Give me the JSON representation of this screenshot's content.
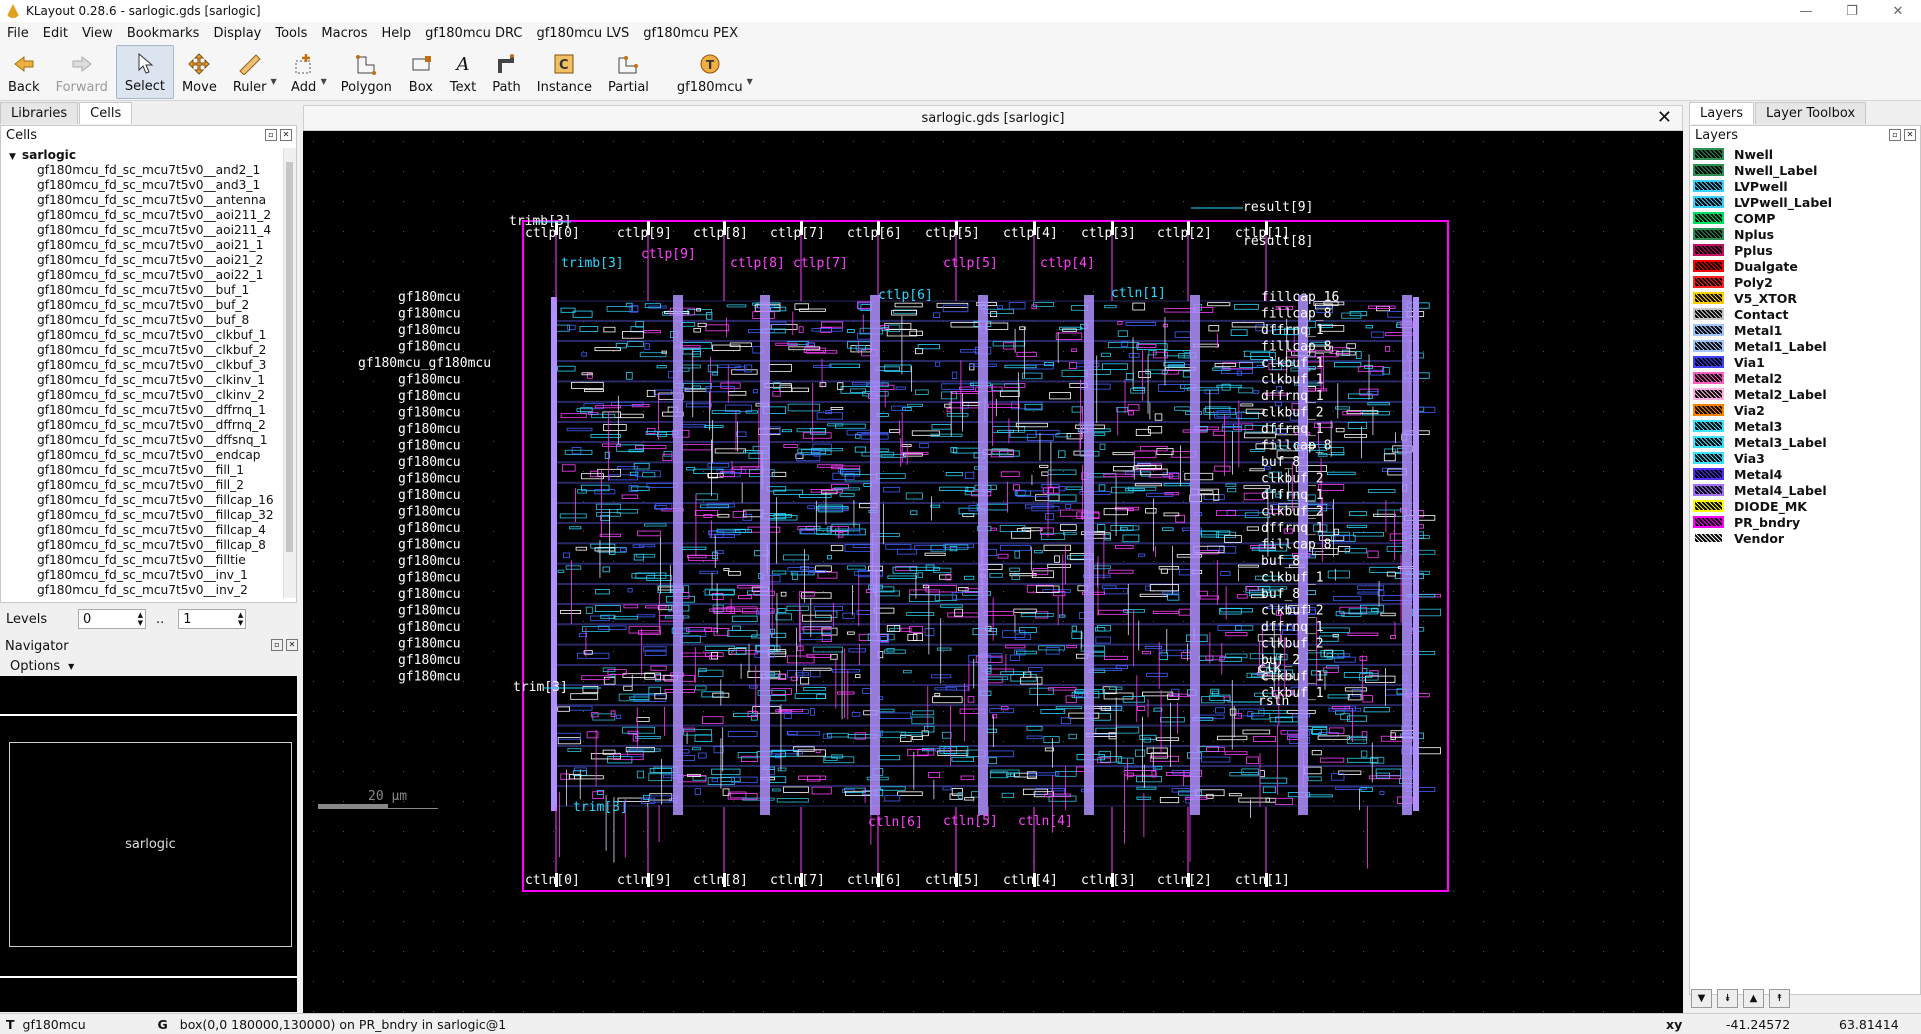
{
  "window": {
    "title": "KLayout 0.28.6 - sarlogic.gds [sarlogic]"
  },
  "menu": [
    "File",
    "Edit",
    "View",
    "Bookmarks",
    "Display",
    "Tools",
    "Macros",
    "Help",
    "gf180mcu DRC",
    "gf180mcu LVS",
    "gf180mcu PEX"
  ],
  "toolbar": {
    "back": "Back",
    "forward": "Forward",
    "select": "Select",
    "move": "Move",
    "ruler": "Ruler",
    "add": "Add",
    "polygon": "Polygon",
    "box": "Box",
    "text": "Text",
    "path": "Path",
    "instance": "Instance",
    "partial": "Partial",
    "tech": "gf180mcu"
  },
  "left_tabs": [
    "Libraries",
    "Cells"
  ],
  "cells": {
    "header": "Cells",
    "root": "sarlogic",
    "items": [
      "gf180mcu_fd_sc_mcu7t5v0__and2_1",
      "gf180mcu_fd_sc_mcu7t5v0__and3_1",
      "gf180mcu_fd_sc_mcu7t5v0__antenna",
      "gf180mcu_fd_sc_mcu7t5v0__aoi211_2",
      "gf180mcu_fd_sc_mcu7t5v0__aoi211_4",
      "gf180mcu_fd_sc_mcu7t5v0__aoi21_1",
      "gf180mcu_fd_sc_mcu7t5v0__aoi21_2",
      "gf180mcu_fd_sc_mcu7t5v0__aoi22_1",
      "gf180mcu_fd_sc_mcu7t5v0__buf_1",
      "gf180mcu_fd_sc_mcu7t5v0__buf_2",
      "gf180mcu_fd_sc_mcu7t5v0__buf_8",
      "gf180mcu_fd_sc_mcu7t5v0__clkbuf_1",
      "gf180mcu_fd_sc_mcu7t5v0__clkbuf_2",
      "gf180mcu_fd_sc_mcu7t5v0__clkbuf_3",
      "gf180mcu_fd_sc_mcu7t5v0__clkinv_1",
      "gf180mcu_fd_sc_mcu7t5v0__clkinv_2",
      "gf180mcu_fd_sc_mcu7t5v0__dffrnq_1",
      "gf180mcu_fd_sc_mcu7t5v0__dffrnq_2",
      "gf180mcu_fd_sc_mcu7t5v0__dffsnq_1",
      "gf180mcu_fd_sc_mcu7t5v0__endcap",
      "gf180mcu_fd_sc_mcu7t5v0__fill_1",
      "gf180mcu_fd_sc_mcu7t5v0__fill_2",
      "gf180mcu_fd_sc_mcu7t5v0__fillcap_16",
      "gf180mcu_fd_sc_mcu7t5v0__fillcap_32",
      "gf180mcu_fd_sc_mcu7t5v0__fillcap_4",
      "gf180mcu_fd_sc_mcu7t5v0__fillcap_8",
      "gf180mcu_fd_sc_mcu7t5v0__filltie",
      "gf180mcu_fd_sc_mcu7t5v0__inv_1",
      "gf180mcu_fd_sc_mcu7t5v0__inv_2"
    ]
  },
  "levels": {
    "label": "Levels",
    "from": "0",
    "sep": "..",
    "to": "1"
  },
  "navigator": {
    "header": "Navigator",
    "options": "Options",
    "cell": "sarlogic"
  },
  "view": {
    "tab_title": "sarlogic.gds [sarlogic]",
    "scale_label": "20 µm",
    "top_pins": [
      "ctlp[0]",
      "ctlp[9]",
      "ctlp[8]",
      "ctlp[7]",
      "ctlp[6]",
      "ctlp[5]",
      "ctlp[4]",
      "ctlp[3]",
      "ctlp[2]",
      "ctlp[1]"
    ],
    "bottom_pins": [
      "ctln[0]",
      "ctln[9]",
      "ctln[8]",
      "ctln[7]",
      "ctln[6]",
      "ctln[5]",
      "ctln[4]",
      "ctln[3]",
      "ctln[2]",
      "ctln[1]"
    ],
    "inner_top_labels": [
      "trimb[3]",
      "ctlp[9]",
      "ctlp[8]",
      "ctlp[7]",
      "ctlp[6]",
      "ctlp[5]",
      "ctlp[4]",
      "ctln[1]"
    ],
    "inner_bottom_labels": [
      "trim[3]",
      "ctln[6]",
      "ctln[5]",
      "ctln[4]"
    ],
    "left_pins": [
      "trimb[3]",
      "trim[3]"
    ],
    "right_pins": [
      "result[9]",
      "result[8]",
      "clk",
      "rstn"
    ],
    "row_left": [
      "gf180mcu",
      "gf180mcu",
      "gf180mcu",
      "gf180mcu",
      "gf180mcu_gf180mcu",
      "gf180mcu",
      "gf180mcu",
      "gf180mcu",
      "gf180mcu",
      "gf180mcu",
      "gf180mcu",
      "gf180mcu",
      "gf180mcu",
      "gf180mcu",
      "gf180mcu",
      "gf180mcu",
      "gf180mcu",
      "gf180mcu",
      "gf180mcu",
      "gf180mcu",
      "gf180mcu",
      "gf180mcu",
      "gf180mcu",
      "gf180mcu"
    ],
    "row_right": [
      "fillcap_16",
      "fillcap_8",
      "dffrnq_1",
      "fillcap_8",
      "clkbuf_1",
      "clkbuf_1",
      "dffrnq_1",
      "clkbuf_2",
      "dffrnq_1",
      "fillcap_8",
      "buf_8",
      "clkbuf_2",
      "dffrnq_1",
      "clkbuf_2",
      "dffrnq_1",
      "fillcap_8",
      "buf_8",
      "clkbuf_1",
      "buf_8",
      "clkbuf_2",
      "dffrnq_1",
      "clkbuf_2",
      "buf_2",
      "clkbuf_1",
      "clkbuf_1"
    ]
  },
  "right_tabs": [
    "Layers",
    "Layer Toolbox"
  ],
  "layers": {
    "header": "Layers",
    "items": [
      {
        "name": "Nwell",
        "color": "#2a8f50"
      },
      {
        "name": "Nwell_Label",
        "color": "#2a8f50"
      },
      {
        "name": "LVPwell",
        "color": "#3ad0ff"
      },
      {
        "name": "LVPwell_Label",
        "color": "#3ad0ff"
      },
      {
        "name": "COMP",
        "color": "#00e060"
      },
      {
        "name": "Nplus",
        "color": "#2a8f50"
      },
      {
        "name": "Pplus",
        "color": "#c01060"
      },
      {
        "name": "Dualgate",
        "color": "#ff0000"
      },
      {
        "name": "Poly2",
        "color": "#ff2020"
      },
      {
        "name": "V5_XTOR",
        "color": "#ffd000"
      },
      {
        "name": "Contact",
        "color": "#c8c8c8"
      },
      {
        "name": "Metal1",
        "color": "#a0c8ff"
      },
      {
        "name": "Metal1_Label",
        "color": "#a0c8ff"
      },
      {
        "name": "Via1",
        "color": "#4040ff"
      },
      {
        "name": "Metal2",
        "color": "#ff60c0"
      },
      {
        "name": "Metal2_Label",
        "color": "#ffb0e0"
      },
      {
        "name": "Via2",
        "color": "#ff8000"
      },
      {
        "name": "Metal3",
        "color": "#40e0ff"
      },
      {
        "name": "Metal3_Label",
        "color": "#40e0ff"
      },
      {
        "name": "Via3",
        "color": "#40e0ff"
      },
      {
        "name": "Metal4",
        "color": "#5030ff"
      },
      {
        "name": "Metal4_Label",
        "color": "#a070ff"
      },
      {
        "name": "DIODE_MK",
        "color": "#ffff00"
      },
      {
        "name": "PR_bndry",
        "color": "#ff00ff"
      },
      {
        "name": "Vendor",
        "color": "#ffffff"
      }
    ]
  },
  "status": {
    "tech_icon": "T",
    "tech": "gf180mcu",
    "g_icon": "G",
    "message": "box(0,0 180000,130000) on PR_bndry in sarlogic@1",
    "xy_label": "xy",
    "x": "-41.24572",
    "y": "63.81414"
  }
}
